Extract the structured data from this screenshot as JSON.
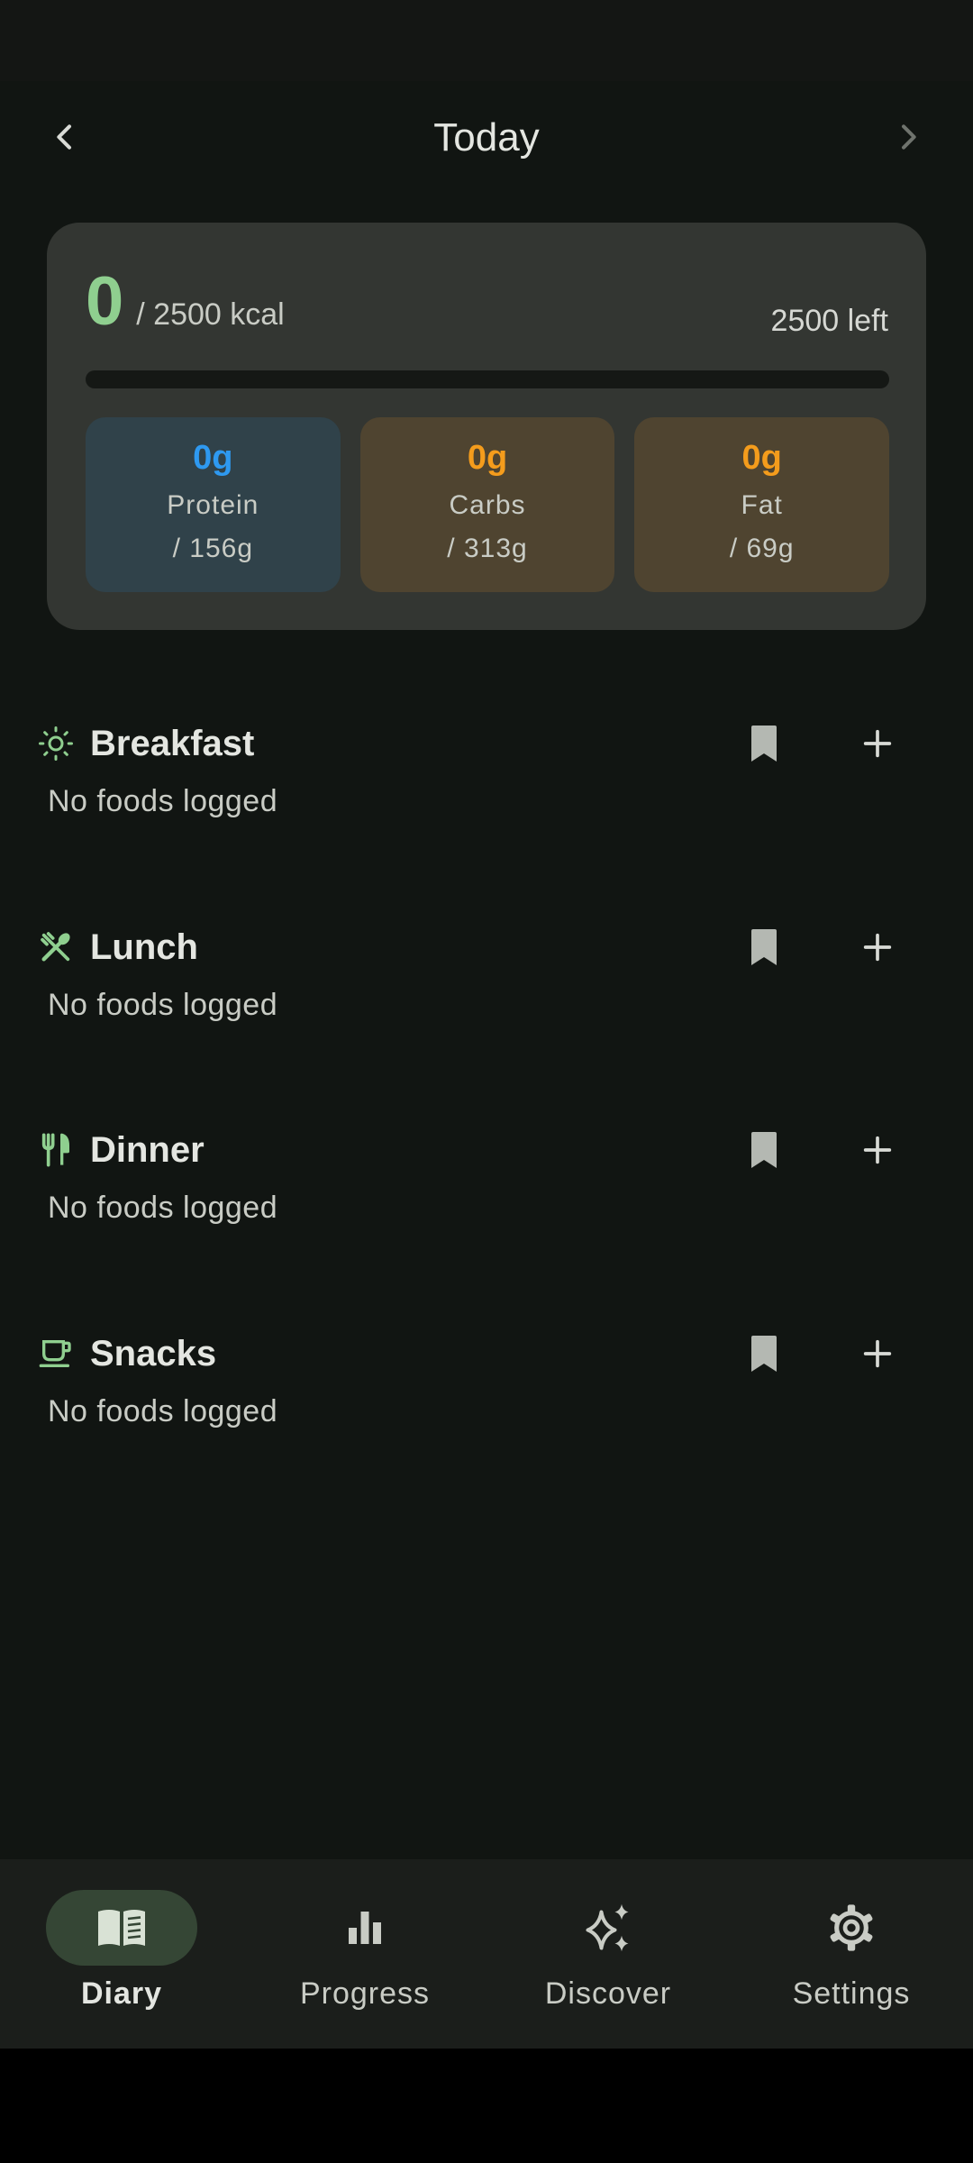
{
  "header": {
    "title": "Today"
  },
  "summary": {
    "calories_consumed": "0",
    "calories_target": "/ 2500 kcal",
    "calories_left": "2500 left",
    "progress_fraction": 0,
    "macros": [
      {
        "value": "0g",
        "name": "Protein",
        "target": "/ 156g"
      },
      {
        "value": "0g",
        "name": "Carbs",
        "target": "/ 313g"
      },
      {
        "value": "0g",
        "name": "Fat",
        "target": "/ 69g"
      }
    ]
  },
  "meals": [
    {
      "title": "Breakfast",
      "icon": "sun-icon",
      "empty": "No foods logged"
    },
    {
      "title": "Lunch",
      "icon": "fork-spoon-icon",
      "empty": "No foods logged"
    },
    {
      "title": "Dinner",
      "icon": "fork-knife-icon",
      "empty": "No foods logged"
    },
    {
      "title": "Snacks",
      "icon": "cup-icon",
      "empty": "No foods logged"
    }
  ],
  "nav": [
    {
      "label": "Diary",
      "icon": "book-icon",
      "active": true
    },
    {
      "label": "Progress",
      "icon": "bar-chart-icon",
      "active": false
    },
    {
      "label": "Discover",
      "icon": "sparkles-icon",
      "active": false
    },
    {
      "label": "Settings",
      "icon": "gear-icon",
      "active": false
    }
  ],
  "colors": {
    "background": "#111512",
    "card": "#333632",
    "accent_green": "#8fcf8f",
    "protein_blue": "#2e99f0",
    "carbs_orange": "#f49c1c"
  }
}
